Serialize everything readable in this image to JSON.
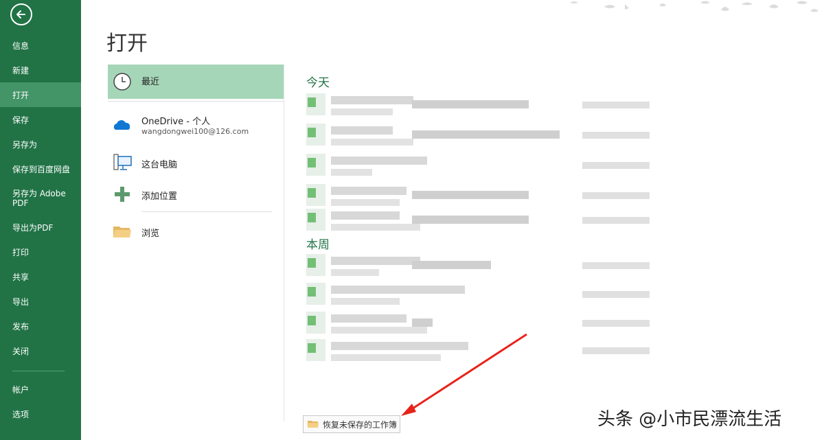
{
  "sidebar": {
    "items": [
      {
        "label": "信息"
      },
      {
        "label": "新建"
      },
      {
        "label": "打开"
      },
      {
        "label": "保存"
      },
      {
        "label": "另存为"
      },
      {
        "label": "保存到百度网盘"
      },
      {
        "label": "另存为 Adobe\nPDF"
      },
      {
        "label": "导出为PDF"
      },
      {
        "label": "打印"
      },
      {
        "label": "共享"
      },
      {
        "label": "导出"
      },
      {
        "label": "发布"
      },
      {
        "label": "关闭"
      },
      {
        "label": "帐户"
      },
      {
        "label": "选项"
      }
    ],
    "active_index": 2
  },
  "main": {
    "title": "打开",
    "locations": [
      {
        "label": "最近",
        "icon": "clock-icon"
      },
      {
        "label": "OneDrive - 个人",
        "sub": "wangdongwei100@126.com",
        "icon": "onedrive-cloud-icon"
      },
      {
        "label": "这台电脑",
        "icon": "computer-icon"
      },
      {
        "label": "添加位置",
        "icon": "plus-icon"
      },
      {
        "label": "浏览",
        "icon": "folder-icon"
      }
    ],
    "groups": [
      {
        "title": "今天",
        "rows": 5
      },
      {
        "title": "本周",
        "rows": 4
      }
    ],
    "recover_button": "恢复未保存的工作簿"
  },
  "overlay": {
    "watermark": "头条 @小市民漂流生活",
    "arrow_color": "#e8231a"
  },
  "colors": {
    "accent": "#217346",
    "active_nav": "#439467",
    "active_location": "#a6d6b8"
  }
}
